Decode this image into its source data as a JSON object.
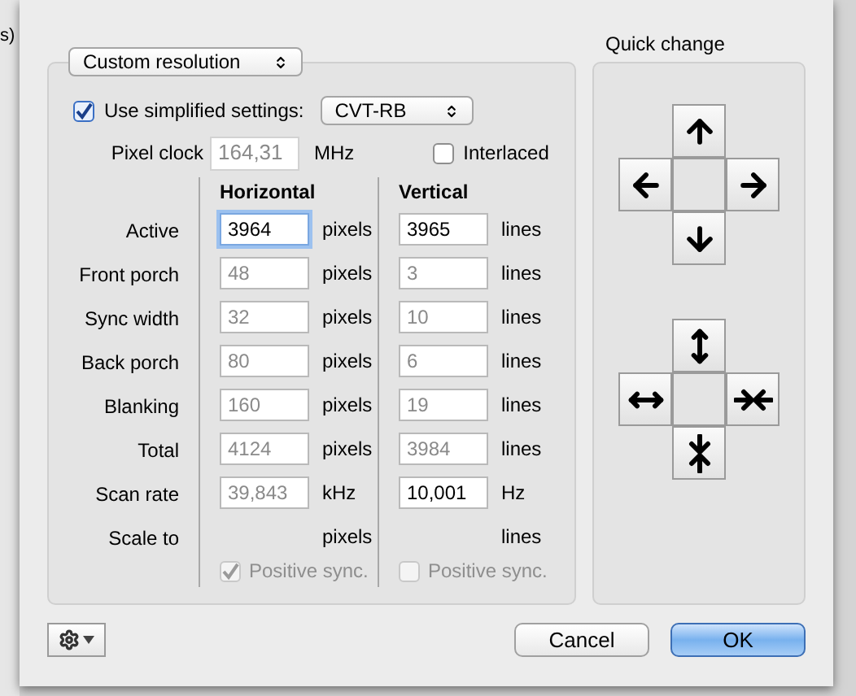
{
  "background": {
    "text": "s)"
  },
  "mode_popup": {
    "value": "Custom resolution"
  },
  "simplified": {
    "label": "Use simplified settings:",
    "checked": true,
    "value": "CVT-RB"
  },
  "pixel_clock": {
    "label": "Pixel clock",
    "value": "164,31",
    "disabled": true,
    "unit": "MHz"
  },
  "interlaced": {
    "label": "Interlaced",
    "checked": false
  },
  "columns": [
    "Horizontal",
    "Vertical"
  ],
  "rows": [
    {
      "label": "Active",
      "horizontal": {
        "value": "3964",
        "unit": "pixels",
        "disabled": false,
        "focused": true
      },
      "vertical": {
        "value": "3965",
        "unit": "lines",
        "disabled": false,
        "focused": false
      }
    },
    {
      "label": "Front porch",
      "horizontal": {
        "value": "48",
        "unit": "pixels",
        "disabled": true,
        "focused": false
      },
      "vertical": {
        "value": "3",
        "unit": "lines",
        "disabled": true,
        "focused": false
      }
    },
    {
      "label": "Sync width",
      "horizontal": {
        "value": "32",
        "unit": "pixels",
        "disabled": true,
        "focused": false
      },
      "vertical": {
        "value": "10",
        "unit": "lines",
        "disabled": true,
        "focused": false
      }
    },
    {
      "label": "Back porch",
      "horizontal": {
        "value": "80",
        "unit": "pixels",
        "disabled": true,
        "focused": false
      },
      "vertical": {
        "value": "6",
        "unit": "lines",
        "disabled": true,
        "focused": false
      }
    },
    {
      "label": "Blanking",
      "horizontal": {
        "value": "160",
        "unit": "pixels",
        "disabled": true,
        "focused": false
      },
      "vertical": {
        "value": "19",
        "unit": "lines",
        "disabled": true,
        "focused": false
      }
    },
    {
      "label": "Total",
      "horizontal": {
        "value": "4124",
        "unit": "pixels",
        "disabled": true,
        "focused": false
      },
      "vertical": {
        "value": "3984",
        "unit": "lines",
        "disabled": true,
        "focused": false
      }
    },
    {
      "label": "Scan rate",
      "horizontal": {
        "value": "39,843",
        "unit": "kHz",
        "disabled": true,
        "focused": false
      },
      "vertical": {
        "value": "10,001",
        "unit": "Hz",
        "disabled": false,
        "focused": false
      }
    },
    {
      "label": "Scale to",
      "horizontal": {
        "unit": "pixels"
      },
      "vertical": {
        "unit": "lines"
      }
    }
  ],
  "positive_sync": [
    {
      "label": "Positive sync.",
      "checked": true,
      "disabled": true
    },
    {
      "label": "Positive sync.",
      "checked": false,
      "disabled": true
    }
  ],
  "quick_change": {
    "title": "Quick change"
  },
  "buttons": [
    {
      "label": "Cancel",
      "default": false
    },
    {
      "label": "OK",
      "default": true
    }
  ]
}
